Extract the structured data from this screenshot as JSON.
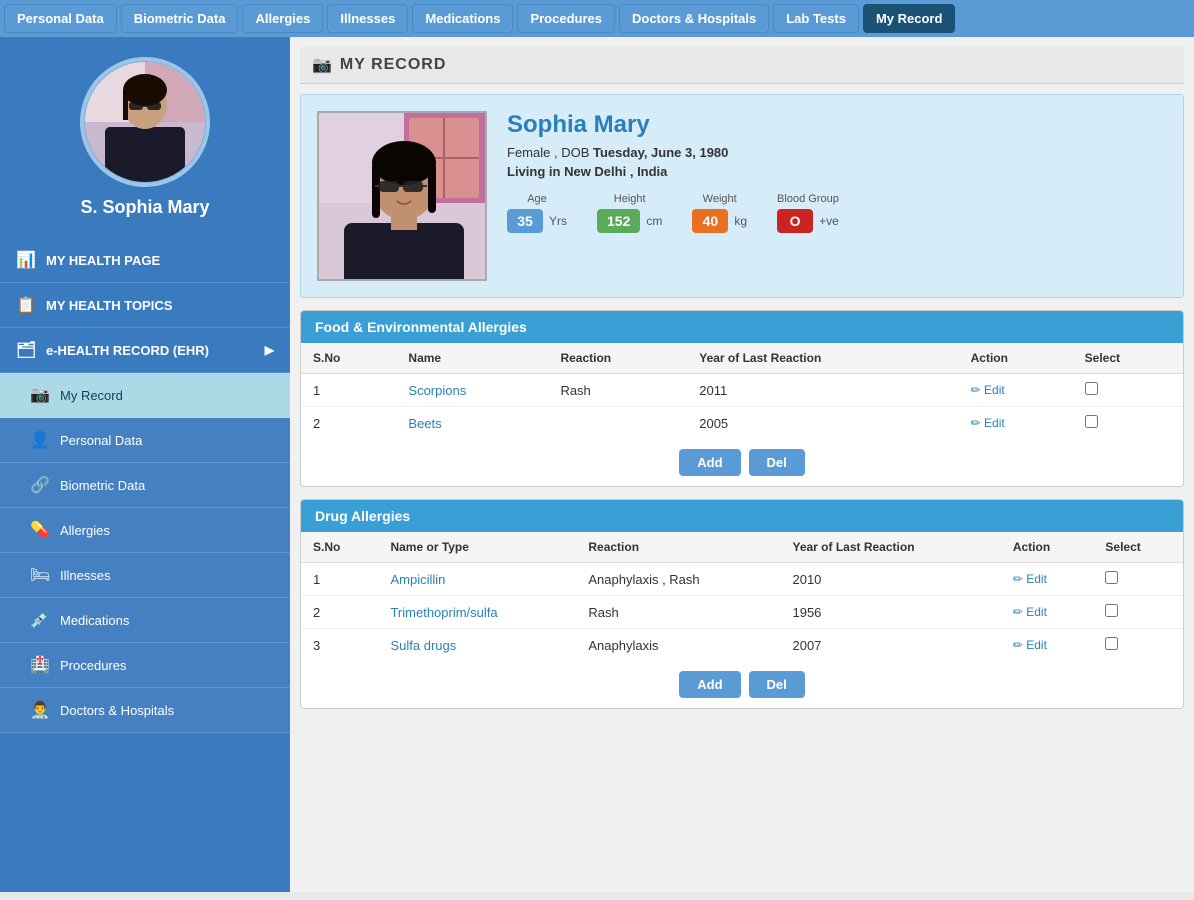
{
  "nav": {
    "items": [
      {
        "label": "Personal Data",
        "active": false
      },
      {
        "label": "Biometric Data",
        "active": false
      },
      {
        "label": "Allergies",
        "active": false
      },
      {
        "label": "Illnesses",
        "active": false
      },
      {
        "label": "Medications",
        "active": false
      },
      {
        "label": "Procedures",
        "active": false
      },
      {
        "label": "Doctors & Hospitals",
        "active": false
      },
      {
        "label": "Lab Tests",
        "active": false
      },
      {
        "label": "My Record",
        "active": true
      }
    ]
  },
  "sidebar": {
    "user_name": "S. Sophia Mary",
    "items": [
      {
        "label": "MY HEALTH PAGE",
        "icon": "📊",
        "active": false,
        "sub": false
      },
      {
        "label": "MY HEALTH TOPICS",
        "icon": "📋",
        "active": false,
        "sub": false
      },
      {
        "label": "e-HEALTH RECORD (EHR)",
        "icon": "🗂",
        "active": false,
        "sub": false,
        "has_arrow": true
      },
      {
        "label": "My Record",
        "icon": "📷",
        "active": true,
        "sub": true
      },
      {
        "label": "Personal Data",
        "icon": "👤",
        "active": false,
        "sub": true
      },
      {
        "label": "Biometric Data",
        "icon": "🔗",
        "active": false,
        "sub": true
      },
      {
        "label": "Allergies",
        "icon": "💊",
        "active": false,
        "sub": true
      },
      {
        "label": "Illnesses",
        "icon": "🛏",
        "active": false,
        "sub": true
      },
      {
        "label": "Medications",
        "icon": "💉",
        "active": false,
        "sub": true
      },
      {
        "label": "Procedures",
        "icon": "🏥",
        "active": false,
        "sub": true
      },
      {
        "label": "Doctors & Hospitals",
        "icon": "👨‍⚕️",
        "active": false,
        "sub": true
      }
    ]
  },
  "main": {
    "page_title": "MY RECORD",
    "profile": {
      "name": "Sophia  Mary",
      "gender": "Female",
      "dob_label": "DOB",
      "dob": "Tuesday, June 3, 1980",
      "location_label": "Living in",
      "location": "New Delhi",
      "country": "India",
      "stats": [
        {
          "label": "Age",
          "value": "35",
          "unit": "Yrs",
          "color": "#5b9bd5"
        },
        {
          "label": "Height",
          "value": "152",
          "unit": "cm",
          "color": "#5aaa5a"
        },
        {
          "label": "Weight",
          "value": "40",
          "unit": "kg",
          "color": "#e87020"
        },
        {
          "label": "Blood Group",
          "value": "O",
          "unit": "+ve",
          "color": "#cc2222"
        }
      ]
    },
    "food_allergies": {
      "title": "Food & Environmental Allergies",
      "columns": [
        "S.No",
        "Name",
        "Reaction",
        "Year of Last Reaction",
        "Action",
        "Select"
      ],
      "rows": [
        {
          "sno": "1",
          "name": "Scorpions",
          "reaction": "Rash",
          "year": "2011"
        },
        {
          "sno": "2",
          "name": "Beets",
          "reaction": "",
          "year": "2005"
        }
      ],
      "add_label": "Add",
      "del_label": "Del"
    },
    "drug_allergies": {
      "title": "Drug Allergies",
      "columns": [
        "S.No",
        "Name or Type",
        "Reaction",
        "Year of Last Reaction",
        "Action",
        "Select"
      ],
      "rows": [
        {
          "sno": "1",
          "name": "Ampicillin",
          "reaction": "Anaphylaxis , Rash",
          "year": "2010"
        },
        {
          "sno": "2",
          "name": "Trimethoprim/sulfa",
          "reaction": "Rash",
          "year": "1956"
        },
        {
          "sno": "3",
          "name": "Sulfa drugs",
          "reaction": "Anaphylaxis",
          "year": "2007"
        }
      ],
      "add_label": "Add",
      "del_label": "Del"
    }
  }
}
